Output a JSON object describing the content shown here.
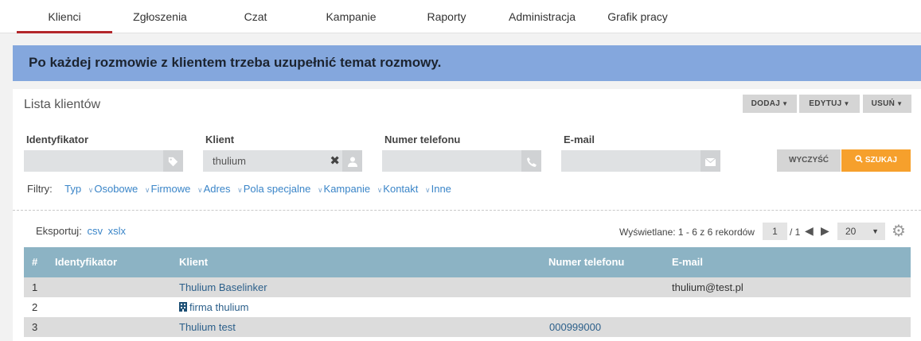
{
  "nav": {
    "tabs": [
      "Klienci",
      "Zgłoszenia",
      "Czat",
      "Kampanie",
      "Raporty",
      "Administracja",
      "Grafik pracy"
    ],
    "active": "Klienci"
  },
  "banner": {
    "text": "Po każdej rozmowie z klientem trzeba uzupełnić temat rozmowy.",
    "color": "#84a7dd"
  },
  "panel": {
    "title": "Lista klientów",
    "buttons": {
      "add": "DODAJ",
      "edit": "EDYTUJ",
      "delete": "USUŃ"
    }
  },
  "search": {
    "fields": {
      "id": {
        "label": "Identyfikator",
        "value": ""
      },
      "client": {
        "label": "Klient",
        "value": "thulium"
      },
      "phone": {
        "label": "Numer telefonu",
        "value": ""
      },
      "email": {
        "label": "E-mail",
        "value": ""
      }
    },
    "clear_label": "WYCZYŚĆ",
    "search_label": "SZUKAJ",
    "search_color": "#f6a02c"
  },
  "filters": {
    "label": "Filtry:",
    "items": [
      "Typ",
      "Osobowe",
      "Firmowe",
      "Adres",
      "Pola specjalne",
      "Kampanie",
      "Kontakt",
      "Inne"
    ]
  },
  "export": {
    "label": "Eksportuj:",
    "csv": "csv",
    "xlsx": "xslx"
  },
  "paging": {
    "summary": "Wyświetlane: 1 - 6 z 6 rekordów",
    "page": "1",
    "total": "/ 1",
    "per_page": "20"
  },
  "table": {
    "columns": [
      "#",
      "Identyfikator",
      "Klient",
      "Numer telefonu",
      "E-mail"
    ],
    "header_color": "#8cb3c4",
    "rows": [
      {
        "num": "1",
        "id": "",
        "client": "Thulium Baselinker",
        "phone": "",
        "email": "thulium@test.pl",
        "company": false
      },
      {
        "num": "2",
        "id": "",
        "client": "firma thulium",
        "phone": "",
        "email": "",
        "company": true
      },
      {
        "num": "3",
        "id": "",
        "client": "Thulium test",
        "phone": "000999000",
        "email": "",
        "company": false
      }
    ]
  },
  "icons": [
    "tag-icon",
    "user-icon",
    "phone-icon",
    "envelope-icon",
    "search-icon",
    "gear-icon",
    "building-icon"
  ]
}
